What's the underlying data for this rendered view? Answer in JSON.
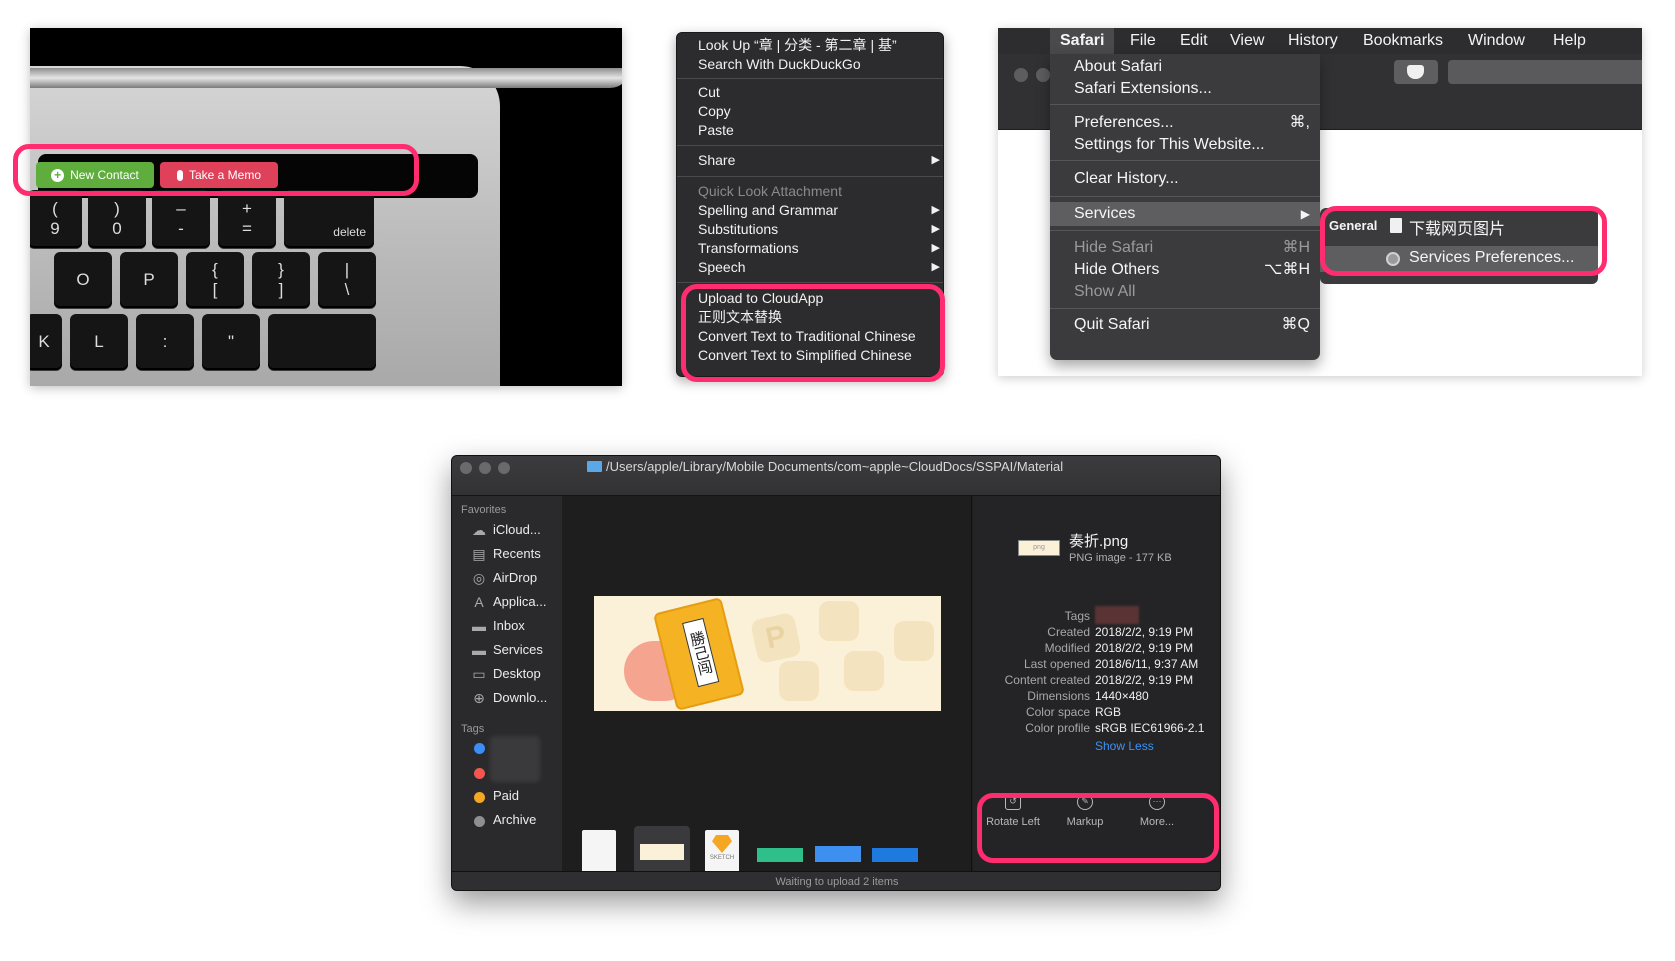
{
  "touchbar": {
    "new_contact": "New Contact",
    "take_memo": "Take a Memo",
    "new_contact_color": "#5fad3c",
    "take_memo_color": "#e0415a",
    "keys": {
      "k1_top": "(",
      "k1_bot": "9",
      "k2_top": ")",
      "k2_bot": "0",
      "k3_top": "–",
      "k3_bot": "-",
      "k4_top": "+",
      "k4_bot": "=",
      "delete": "delete",
      "o": "O",
      "p": "P",
      "b1_top": "{",
      "b1_bot": "[",
      "b2_top": "}",
      "b2_bot": "]",
      "pipe_top": "|",
      "pipe_bot": "\\",
      "k": "K",
      "l": "L",
      "colon": ":",
      "quote": "\""
    }
  },
  "context_menu": {
    "look_up": "Look Up “章 | 分类 - 第二章 | 基”",
    "search": "Search With DuckDuckGo",
    "cut": "Cut",
    "copy": "Copy",
    "paste": "Paste",
    "share": "Share",
    "quick_look": "Quick Look Attachment",
    "spelling": "Spelling and Grammar",
    "substitutions": "Substitutions",
    "transformations": "Transformations",
    "speech": "Speech",
    "upload": "Upload to CloudApp",
    "regex": "正则文本替换",
    "trad": "Convert Text to Traditional Chinese",
    "simp": "Convert Text to Simplified Chinese",
    "arrow": "▶"
  },
  "safari": {
    "menubar": [
      "Safari",
      "File",
      "Edit",
      "View",
      "History",
      "Bookmarks",
      "Window",
      "Help"
    ],
    "apple": "",
    "about": "About Safari",
    "extensions": "Safari Extensions...",
    "preferences": "Preferences...",
    "preferences_key": "⌘,",
    "settings_site": "Settings for This Website...",
    "clear_history": "Clear History...",
    "services": "Services",
    "hide_safari": "Hide Safari",
    "hide_safari_key": "⌘H",
    "hide_others": "Hide Others",
    "hide_others_key": "⌥⌘H",
    "show_all": "Show All",
    "quit": "Quit Safari",
    "quit_key": "⌘Q",
    "submenu_header": "General",
    "submenu_item": "下载网页图片",
    "submenu_prefs": "Services Preferences..."
  },
  "finder": {
    "path": "/Users/apple/Library/Mobile Documents/com~apple~CloudDocs/SSPAI/Material",
    "favorites_header": "Favorites",
    "favorites": [
      "iCloud...",
      "Recents",
      "AirDrop",
      "Applica...",
      "Inbox",
      "Services",
      "Desktop",
      "Downlo..."
    ],
    "tags_header": "Tags",
    "tags": [
      {
        "name": "",
        "color": "#3a8ef6"
      },
      {
        "name": "",
        "color": "#f2574f"
      },
      {
        "name": "Paid",
        "color": "#f5a623"
      },
      {
        "name": "Archive",
        "color": "#8e8e93"
      }
    ],
    "file_name": "奏折.png",
    "file_kind": "PNG image - 177 KB",
    "thumb_mini_label": "png",
    "preview_seal": "勝己闯",
    "meta": [
      {
        "key": "Tags",
        "value": ""
      },
      {
        "key": "Created",
        "value": "2018/2/2, 9:19 PM"
      },
      {
        "key": "Modified",
        "value": "2018/2/2, 9:19 PM"
      },
      {
        "key": "Last opened",
        "value": "2018/6/11, 9:37 AM"
      },
      {
        "key": "Content created",
        "value": "2018/2/2, 9:19 PM"
      },
      {
        "key": "Dimensions",
        "value": "1440×480"
      },
      {
        "key": "Color space",
        "value": "RGB"
      },
      {
        "key": "Color profile",
        "value": "sRGB IEC61966-2.1"
      }
    ],
    "show_less": "Show Less",
    "actions": {
      "rotate": "Rotate Left",
      "markup": "Markup",
      "more": "More..."
    },
    "sketch_label": "SKETCH",
    "status": "Waiting to upload 2 items"
  },
  "accent": "#ff2d6f"
}
